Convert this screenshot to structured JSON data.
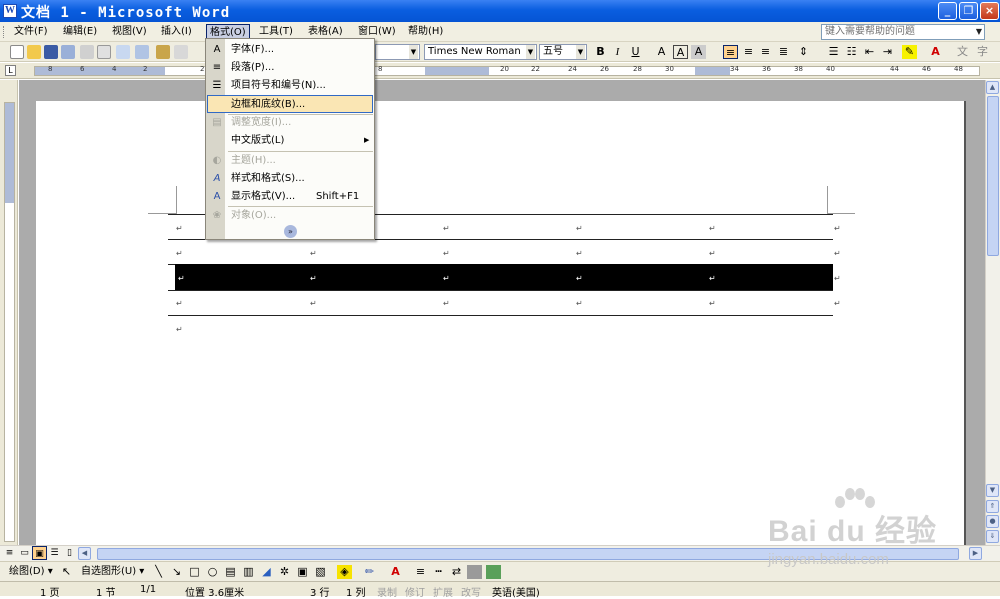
{
  "window": {
    "title": "文档 1 - Microsoft Word",
    "app_icon": "W"
  },
  "menubar": {
    "items": [
      "文件(F)",
      "编辑(E)",
      "视图(V)",
      "插入(I)",
      "格式(O)",
      "工具(T)",
      "表格(A)",
      "窗口(W)",
      "帮助(H)"
    ],
    "help_placeholder": "键入需要帮助的问题"
  },
  "toolbar": {
    "font_name": "Times New Roman",
    "font_size": "五号",
    "bold": "B",
    "italic": "I",
    "underline": "U"
  },
  "ruler": {
    "h_ticks": [
      "8",
      "6",
      "4",
      "2",
      "2",
      "4",
      "6",
      "8",
      "20",
      "22",
      "24",
      "26",
      "28",
      "30",
      "34",
      "36",
      "38",
      "40",
      "44",
      "46",
      "48"
    ]
  },
  "format_menu": {
    "items": [
      {
        "label": "字体(F)...",
        "icon": "A",
        "disabled": false
      },
      {
        "label": "段落(P)...",
        "icon": "≡",
        "disabled": false
      },
      {
        "label": "项目符号和编号(N)...",
        "icon": "☰",
        "disabled": false
      },
      {
        "label": "边框和底纹(B)...",
        "icon": "",
        "disabled": false,
        "highlighted": true
      },
      {
        "label": "调整宽度(I)...",
        "icon": "▤",
        "disabled": true
      },
      {
        "label": "中文版式(L)",
        "icon": "",
        "disabled": false,
        "submenu": true
      },
      {
        "label": "主题(H)...",
        "icon": "◐",
        "disabled": true
      },
      {
        "label": "样式和格式(S)...",
        "icon": "A",
        "disabled": false
      },
      {
        "label": "显示格式(V)...",
        "shortcut": "Shift+F1",
        "icon": "A",
        "disabled": false
      },
      {
        "label": "对象(O)...",
        "icon": "❀",
        "disabled": true
      }
    ],
    "expand_icon": "»"
  },
  "document": {
    "paragraph_mark": "↵"
  },
  "drawing_toolbar": {
    "draw_label": "绘图(D)",
    "autoshapes_label": "自选图形(U)"
  },
  "statusbar": {
    "page": "1 页",
    "section": "1 节",
    "page_of": "1/1",
    "position": "位置 3.6厘米",
    "line": "3 行",
    "column": "1 列",
    "rec": "录制",
    "trk": "修订",
    "ext": "扩展",
    "ovr": "改写",
    "language": "英语(美国)"
  },
  "watermark": {
    "brand": "Bai du 经验",
    "url": "jingyan.baidu.com"
  }
}
